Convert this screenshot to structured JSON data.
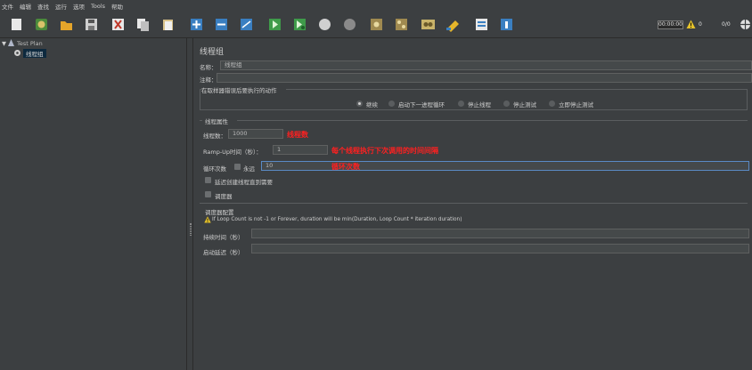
{
  "menu": [
    "文件",
    "编辑",
    "查找",
    "运行",
    "选项",
    "Tools",
    "帮助"
  ],
  "toolbar": {
    "timer": "00:00:00",
    "warning_count": "0",
    "thread_ratio": "0/0"
  },
  "tree": {
    "root": "Test Plan",
    "child": "线程组"
  },
  "panel": {
    "title": "线程组",
    "name_label": "名称：",
    "name_value": "线程组",
    "comment_label": "注释：",
    "error_section": "在取样器错误后要执行的动作",
    "error_options": [
      "继续",
      "启动下一进程循环",
      "停止线程",
      "停止测试",
      "立即停止测试"
    ],
    "error_selected": "继续",
    "props_section": "线程属性",
    "threads_label": "线程数：",
    "threads_value": "1000",
    "threads_note": "线程数",
    "rampup_label": "Ramp-Up时间（秒）：",
    "rampup_value": "1",
    "rampup_note": "每个线程执行下次调用的时间间隔",
    "loop_label": "循环次数",
    "forever_label": "永远",
    "loop_value": "10",
    "loop_note": "循环次数",
    "delay_label": "延迟创建线程直到需要",
    "scheduler_label": "调度器",
    "sched_section": "调度器配置",
    "sched_warning": "If Loop Count is not -1 or Forever, duration will be min(Duration, Loop Count * iteration duration)",
    "duration_label": "持续时间（秒）",
    "startup_label": "启动延迟（秒）"
  },
  "colors": {
    "background": "#3c3f41",
    "accent_red": "#ff2020",
    "selection": "#0d293e"
  }
}
